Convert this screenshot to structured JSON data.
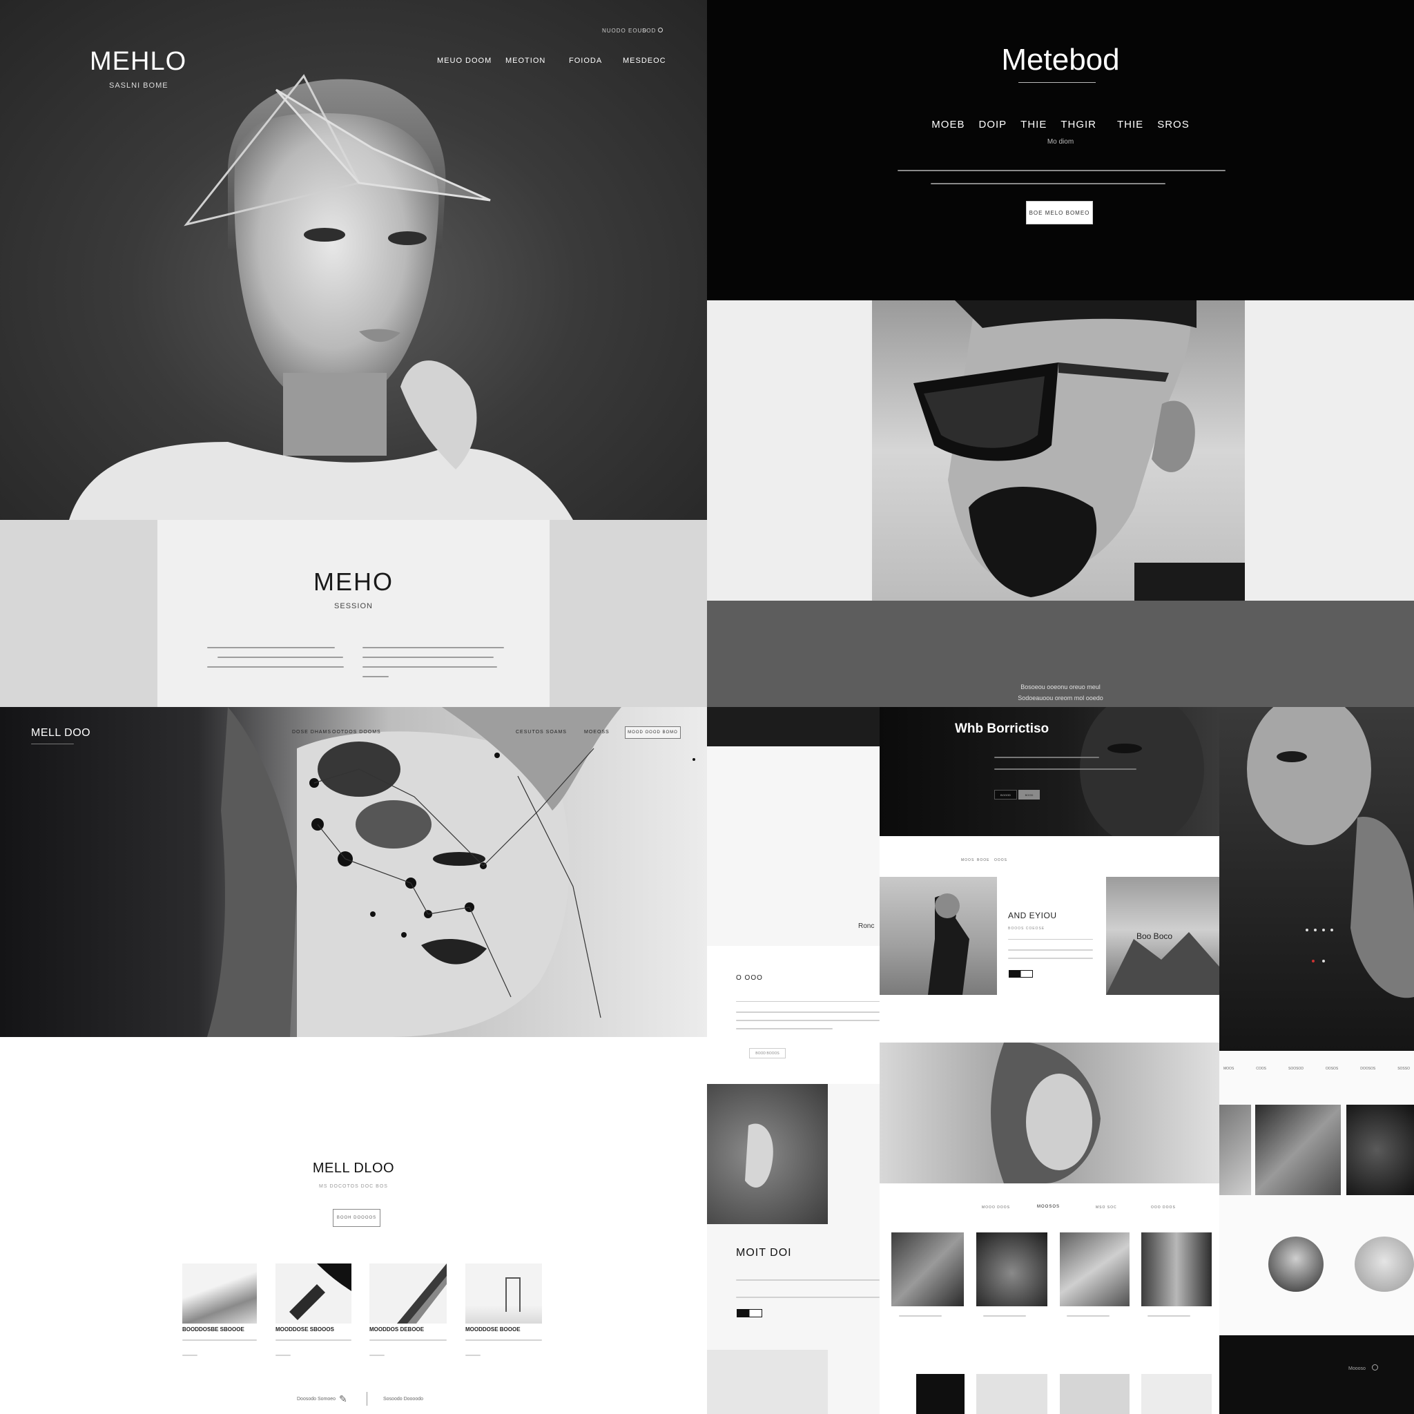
{
  "q1": {
    "logo": "MEHLO",
    "tagline": "SASLNI BOME",
    "top_links": [
      "nuodo eoud",
      "sod"
    ],
    "nav": [
      "MEUO DOOM",
      "MEOTION",
      "FOIODA",
      "MESDEOC"
    ],
    "panel_title": "MEHO",
    "panel_subtitle": "SESSION"
  },
  "q2": {
    "title": "Metebod",
    "nav": [
      "MOEB",
      "DOIP",
      "THIE",
      "THGIR",
      "THIE",
      "SROS"
    ],
    "nav_sub": "Mo diom",
    "cta": "BOE MELO BOMEO",
    "caption_1": "Bosoeou ooeonu oreuo meul",
    "caption_2": "Sodoeauoou oreom mol ooedo"
  },
  "q3": {
    "logo": "MELL DOO",
    "nav": [
      "DOSE DHAMS",
      "OOTDOS DOOMS",
      "CESUTOS SOAMS",
      "MOEOSS"
    ],
    "nav_button": "MOOD OOOD BOMO",
    "section_title": "MELL DLOO",
    "section_sub": "MS DOCOTOS DOC BOS",
    "section_button": "BOOH DOOOOS",
    "cards": [
      {
        "title": "BOODDOSBE SBOOOE"
      },
      {
        "title": "MOODDOSE SBOOOS"
      },
      {
        "title": "MOODDOS DEBOOE"
      },
      {
        "title": "MOODDOSE BOOOE"
      }
    ],
    "footer_left": "Doosodo Somoeo",
    "footer_right": "Sosoodo Doooodo"
  },
  "q4": {
    "hero_title": "Whb Borrictiso",
    "hero_btn_1": "BOOOD",
    "hero_btn_2": "BOOD",
    "small_nav": [
      "MOOS",
      "BOOE",
      "OOOS"
    ],
    "feature_title": "AND EYIOU",
    "feature_sub": "BOOOS COEOSE",
    "overlay_text": "Boo Boco",
    "side_label": "Ronc",
    "left_title": "O OOO",
    "mid_button": "BOOD BOOOS",
    "strip_labels": [
      "MOOO DOOS",
      "MSO SOC",
      "OOO DOOS"
    ],
    "strip_center": "MOOSOS",
    "mosaic_title": "MOIT DOI",
    "right_nav": [
      "MOOS",
      "COOS",
      "SOOSOD",
      "OOSOS",
      "DOOSOS",
      "SOSSO"
    ],
    "bottom_right": "Moooso"
  }
}
